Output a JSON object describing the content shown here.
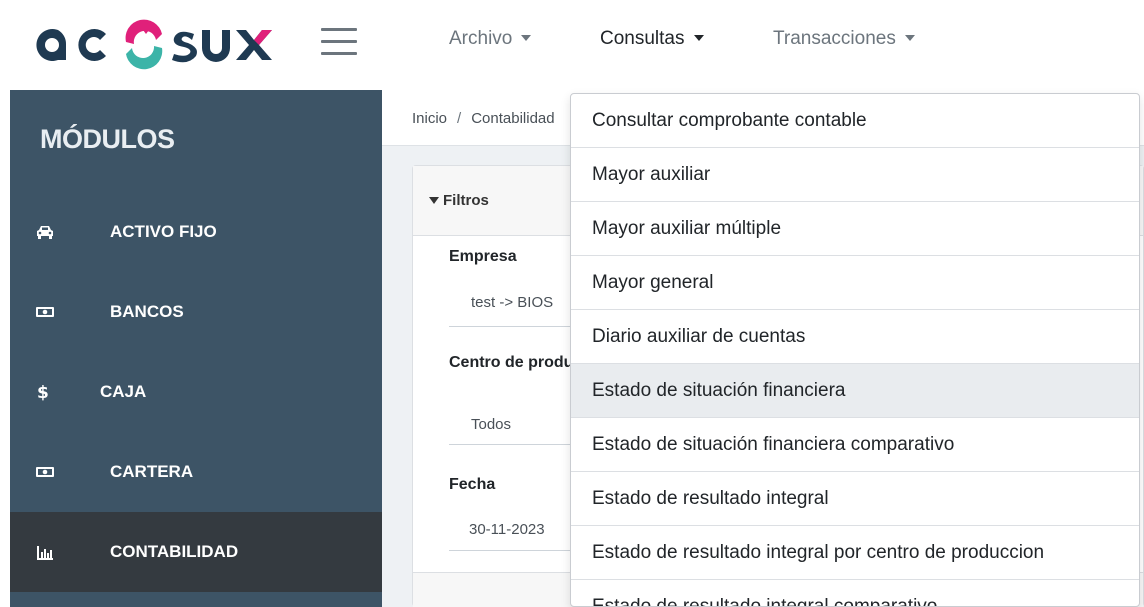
{
  "brand": {
    "logo_text": "acosux",
    "colors": {
      "navy": "#1f3a52",
      "magenta": "#e0207a",
      "teal": "#3cb4a8"
    }
  },
  "nav": [
    {
      "label": "Archivo",
      "active": false
    },
    {
      "label": "Consultas",
      "active": true
    },
    {
      "label": "Transacciones",
      "active": false
    }
  ],
  "sidebar": {
    "title": "MÓDULOS",
    "items": [
      {
        "label": "ACTIVO FIJO",
        "icon": "car-icon"
      },
      {
        "label": "BANCOS",
        "icon": "money-bill-icon"
      },
      {
        "label": "CAJA",
        "icon": "dollar-icon"
      },
      {
        "label": "CARTERA",
        "icon": "money-bill-icon"
      },
      {
        "label": "CONTABILIDAD",
        "icon": "bar-chart-icon",
        "active": true
      }
    ]
  },
  "breadcrumb": {
    "home": "Inicio",
    "separator": "/",
    "current": "Contabilidad"
  },
  "filters": {
    "title": "Filtros",
    "empresa": {
      "label": "Empresa",
      "value": "test -> BIOS"
    },
    "centro": {
      "label": "Centro de produccion",
      "value": "Todos"
    },
    "fecha": {
      "label": "Fecha",
      "value": "30-11-2023"
    }
  },
  "dropdown": {
    "items": [
      "Consultar comprobante contable",
      "Mayor auxiliar",
      "Mayor auxiliar múltiple",
      "Mayor general",
      "Diario auxiliar de cuentas",
      "Estado de situación financiera",
      "Estado de situación financiera comparativo",
      "Estado de resultado integral",
      "Estado de resultado integral por centro de produccion",
      "Estado de resultado integral comparativo"
    ],
    "hovered_index": 5
  }
}
